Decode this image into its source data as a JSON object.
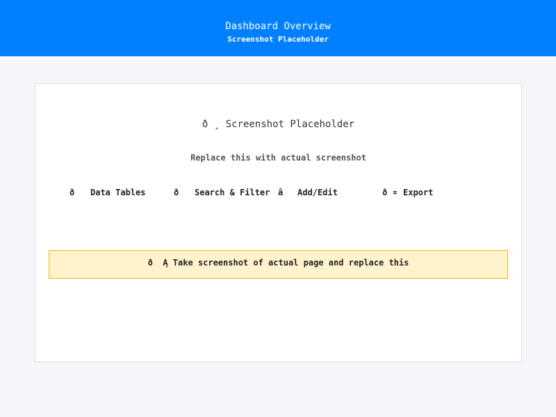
{
  "header": {
    "title": "Dashboard Overview",
    "subtitle": "Screenshot Placeholder",
    "background_color": "#0080ff"
  },
  "placeholder": {
    "title": "ð  ¸ Screenshot Placeholder",
    "subtitle": "Replace this with actual screenshot"
  },
  "features": [
    {
      "glyph": "ð",
      "label": "Data Tables"
    },
    {
      "glyph": "ð",
      "label": "Search & Filter"
    },
    {
      "glyph": "â",
      "label": "Add/Edit"
    },
    {
      "glyph": "ð ¤",
      "label": "Export"
    }
  ],
  "notice": {
    "text": "ð  Ą Take screenshot of actual page and replace this",
    "background_color": "#fff3cd",
    "border_color": "#e8b80e"
  }
}
